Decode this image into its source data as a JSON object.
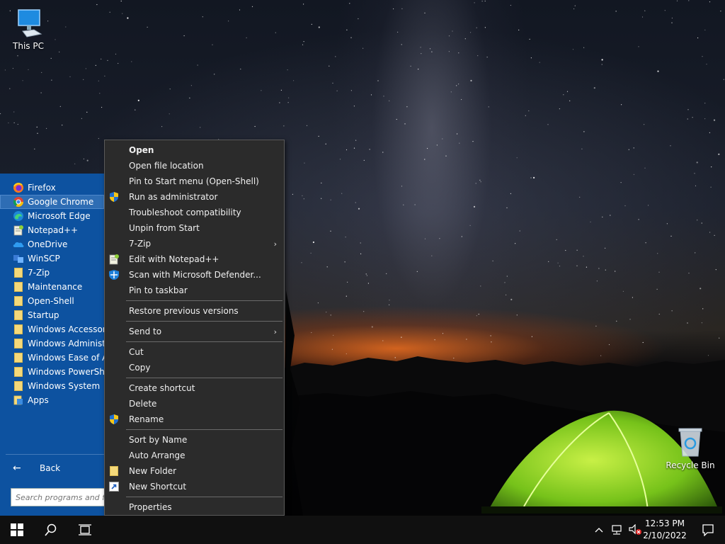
{
  "desktop": {
    "icons": [
      {
        "label": "This PC",
        "icon": "computer-icon"
      },
      {
        "label": "Recycle Bin",
        "icon": "recycle-bin-icon"
      }
    ]
  },
  "start_menu": {
    "items": [
      {
        "label": "Firefox",
        "icon": "firefox-icon"
      },
      {
        "label": "Google Chrome",
        "icon": "chrome-icon",
        "highlighted": true
      },
      {
        "label": "Microsoft Edge",
        "icon": "edge-icon"
      },
      {
        "label": "Notepad++",
        "icon": "notepad-plus-plus-icon"
      },
      {
        "label": "OneDrive",
        "icon": "onedrive-icon"
      },
      {
        "label": "WinSCP",
        "icon": "winscp-icon"
      },
      {
        "label": "7-Zip",
        "icon": "folder-icon"
      },
      {
        "label": "Maintenance",
        "icon": "folder-icon"
      },
      {
        "label": "Open-Shell",
        "icon": "folder-icon"
      },
      {
        "label": "Startup",
        "icon": "folder-icon"
      },
      {
        "label": "Windows Accessories",
        "icon": "folder-icon"
      },
      {
        "label": "Windows Administrative Tools",
        "icon": "folder-icon"
      },
      {
        "label": "Windows Ease of Access",
        "icon": "folder-icon"
      },
      {
        "label": "Windows PowerShell",
        "icon": "folder-icon"
      },
      {
        "label": "Windows System",
        "icon": "folder-icon"
      },
      {
        "label": "Apps",
        "icon": "apps-icon"
      }
    ],
    "back_label": "Back",
    "search_placeholder": "Search programs and files"
  },
  "context_menu": {
    "groups": [
      [
        {
          "label": "Open",
          "bold": true
        },
        {
          "label": "Open file location"
        },
        {
          "label": "Pin to Start menu (Open-Shell)"
        },
        {
          "label": "Run as administrator",
          "icon": "uac-shield-icon"
        },
        {
          "label": "Troubleshoot compatibility"
        },
        {
          "label": "Unpin from Start"
        },
        {
          "label": "7-Zip",
          "submenu": true
        },
        {
          "label": "Edit with Notepad++",
          "icon": "notepad-plus-plus-icon"
        },
        {
          "label": "Scan with Microsoft Defender...",
          "icon": "defender-icon"
        },
        {
          "label": "Pin to taskbar"
        }
      ],
      [
        {
          "label": "Restore previous versions"
        }
      ],
      [
        {
          "label": "Send to",
          "submenu": true
        }
      ],
      [
        {
          "label": "Cut"
        },
        {
          "label": "Copy"
        }
      ],
      [
        {
          "label": "Create shortcut"
        },
        {
          "label": "Delete"
        },
        {
          "label": "Rename",
          "icon": "uac-shield-icon"
        }
      ],
      [
        {
          "label": "Sort by Name"
        },
        {
          "label": "Auto Arrange"
        },
        {
          "label": "New Folder",
          "icon": "folder-icon"
        },
        {
          "label": "New Shortcut",
          "icon": "shortcut-icon"
        }
      ],
      [
        {
          "label": "Properties"
        }
      ]
    ]
  },
  "taskbar": {
    "time": "12:53 PM",
    "date": "2/10/2022"
  }
}
